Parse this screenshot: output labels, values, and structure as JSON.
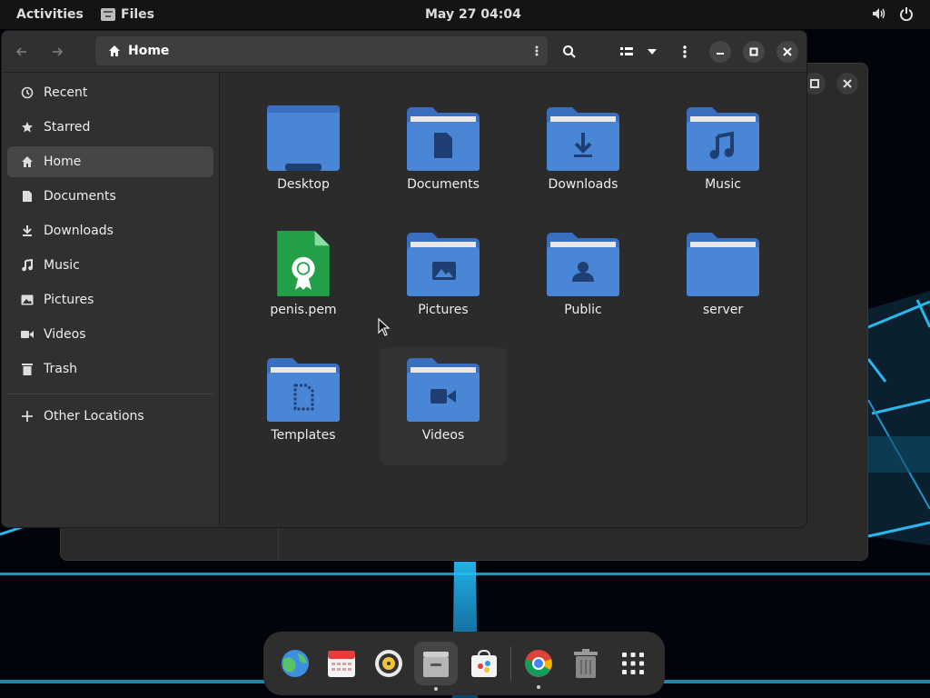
{
  "topbar": {
    "activities": "Activities",
    "app_name": "Files",
    "clock": "May 27  04:04",
    "icons": [
      "volume-icon",
      "power-icon"
    ]
  },
  "window": {
    "location": "Home",
    "sidebar": {
      "items": [
        {
          "label": "Recent",
          "icon": "clock-icon"
        },
        {
          "label": "Starred",
          "icon": "star-icon"
        },
        {
          "label": "Home",
          "icon": "home-icon",
          "active": true
        },
        {
          "label": "Documents",
          "icon": "document-icon"
        },
        {
          "label": "Downloads",
          "icon": "download-icon"
        },
        {
          "label": "Music",
          "icon": "music-icon"
        },
        {
          "label": "Pictures",
          "icon": "picture-icon"
        },
        {
          "label": "Videos",
          "icon": "video-icon"
        },
        {
          "label": "Trash",
          "icon": "trash-icon"
        }
      ],
      "other": {
        "label": "Other Locations",
        "icon": "plus-icon"
      }
    },
    "files": [
      {
        "name": "Desktop",
        "type": "desktop-folder-icon"
      },
      {
        "name": "Documents",
        "type": "documents-folder-icon"
      },
      {
        "name": "Downloads",
        "type": "downloads-folder-icon"
      },
      {
        "name": "Music",
        "type": "music-folder-icon"
      },
      {
        "name": "penis.pem",
        "type": "certificate-file-icon"
      },
      {
        "name": "Pictures",
        "type": "pictures-folder-icon"
      },
      {
        "name": "Public",
        "type": "public-folder-icon"
      },
      {
        "name": "server",
        "type": "folder-icon"
      },
      {
        "name": "Templates",
        "type": "templates-folder-icon"
      },
      {
        "name": "Videos",
        "type": "videos-folder-icon"
      }
    ]
  },
  "dock": {
    "apps": [
      "web-browser-icon",
      "calendar-icon",
      "music-player-icon",
      "files-icon",
      "software-center-icon",
      "chrome-icon",
      "trash-icon",
      "app-grid-icon"
    ]
  },
  "colors": {
    "folder_body": "#4a86d6",
    "folder_tab": "#3a6fbf",
    "folder_sheet": "#e8e8e8",
    "emblem": "#1f3f73",
    "pem_green": "#23a047"
  }
}
